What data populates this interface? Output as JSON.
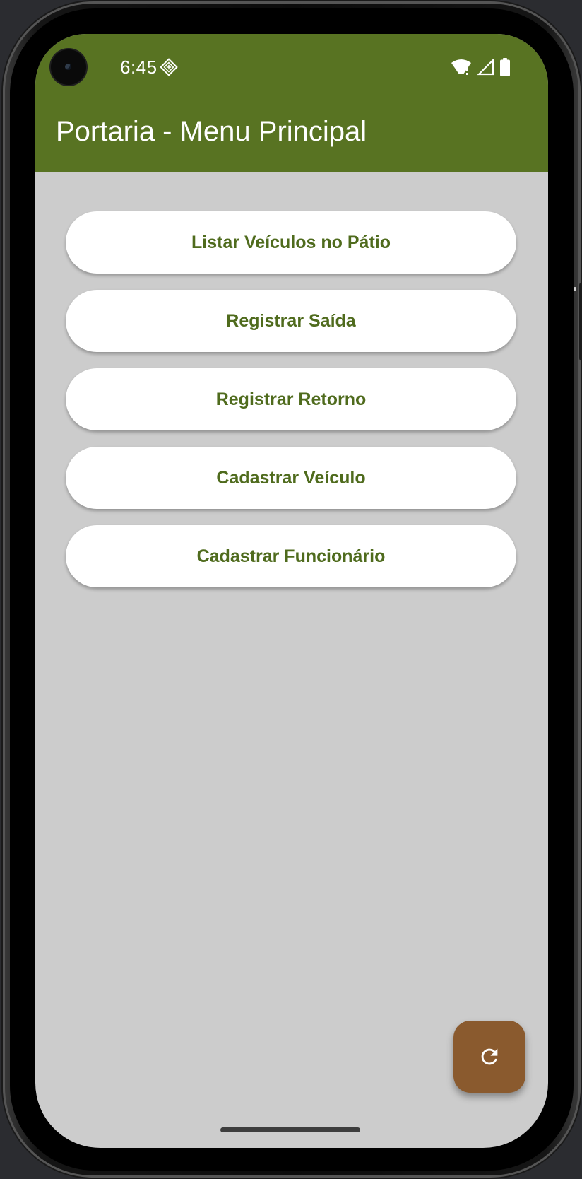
{
  "status_bar": {
    "time": "6:45"
  },
  "app_bar": {
    "title": "Portaria - Menu Principal",
    "color": "#587322"
  },
  "menu": {
    "items": [
      {
        "label": "Listar Veículos no Pátio"
      },
      {
        "label": "Registrar Saída"
      },
      {
        "label": "Registrar Retorno"
      },
      {
        "label": "Cadastrar Veículo"
      },
      {
        "label": "Cadastrar Funcionário"
      }
    ],
    "text_color": "#4f6b1d"
  },
  "fab": {
    "icon": "refresh-icon",
    "color": "#8a5a2e"
  },
  "colors": {
    "background": "#cccccc"
  }
}
